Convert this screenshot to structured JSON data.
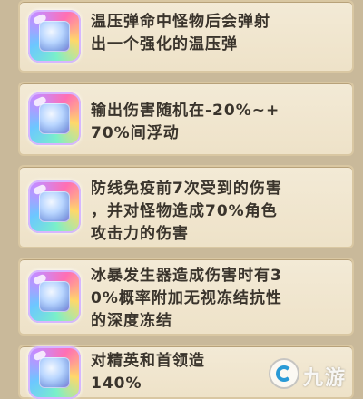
{
  "items": [
    {
      "icon": "upgrade-gem-icon",
      "line1": "温压弹命中怪物后会弹射",
      "line2": "出一个强化的温压弹",
      "line3": ""
    },
    {
      "icon": "upgrade-gem-icon",
      "line1": "输出伤害随机在-20%~+",
      "line2": "70%间浮动",
      "line3": ""
    },
    {
      "icon": "upgrade-gem-icon",
      "line1": "防线免疫前7次受到的伤害",
      "line2": "，并对怪物造成70%角色",
      "line3": "攻击力的伤害"
    },
    {
      "icon": "upgrade-gem-icon",
      "line1": "冰暴发生器造成伤害时有3",
      "line2": "0%概率附加无视冻结抗性",
      "line3": "的深度冻结"
    },
    {
      "icon": "upgrade-gem-icon",
      "line1": "对精英和首领造",
      "line2": "140%",
      "line3": ""
    }
  ],
  "watermark": {
    "text": "九游",
    "icon": "jiuyou-logo-icon"
  },
  "colors": {
    "card": "#f3ead6",
    "border": "#d9c7a2",
    "text": "#3a342c",
    "background": "#c9b99a"
  }
}
